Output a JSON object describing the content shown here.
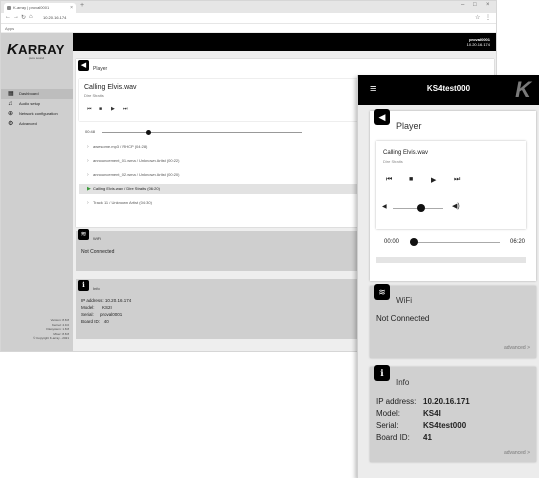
{
  "browser": {
    "tab_title": "K-array | proval0001",
    "new_tab": "+",
    "window_controls": [
      "–",
      "□",
      "×"
    ],
    "url": "10.20.16.174",
    "bookmarks": "Apps"
  },
  "desktop": {
    "logo": {
      "k": "K",
      "text": "ARRAY",
      "tagline": "pure sound"
    },
    "nav": [
      {
        "label": "Dashboard",
        "icon": "dashboard-icon"
      },
      {
        "label": "Audio setup",
        "icon": "music-icon"
      },
      {
        "label": "Network configuration",
        "icon": "network-icon"
      },
      {
        "label": "Advanced",
        "icon": "gear-icon"
      }
    ],
    "side_info": [
      "Version: 8.8.8",
      "Kernel: 4.9.0",
      "Filesystem: 1.8.8",
      "Mixer: 8.8.8",
      "© Copyright K-array - 2021"
    ],
    "device": {
      "name": "proval0001",
      "ip": "10.20.16.174"
    },
    "player": {
      "title": "Player",
      "track": "Calling Elvis.wav",
      "artist": "Dire Straits",
      "time": "00:48",
      "playlist": [
        "awesome.mp3 / RHCP (04:28)",
        "announcement_01.wma / Unknown Artist (00:22)",
        "announcement_02.wma / Unknown Artist (00:20)",
        "Calling Elvis.wav / Dire Straits (06:20)",
        "Track 11 / Unknown Artist (04:30)"
      ]
    },
    "wifi": {
      "title": "WiFi",
      "status": "Not Connected"
    },
    "info": {
      "title": "Info",
      "ip": "IP address: 10.20.16.174",
      "model": "Model:      KS2I",
      "serial": "Serial:     proval0001",
      "board": "Board ID:   40"
    }
  },
  "mobile": {
    "title": "KS4test000",
    "logo": "K",
    "player": {
      "title": "Player",
      "track": "Calling Elvis.wav",
      "artist": "Dire Straits",
      "time_start": "00:00",
      "time_end": "06:20",
      "volume_level": 0.55,
      "progress": 0.0
    },
    "wifi": {
      "title": "WiFi",
      "status": "Not Connected",
      "advanced": "advanced >"
    },
    "info": {
      "title": "Info",
      "ip_label": "IP address:",
      "ip_value": "10.20.16.171",
      "model_label": "Model:",
      "model_value": "KS4I",
      "serial_label": "Serial:",
      "serial_value": "KS4test000",
      "board_label": "Board ID:",
      "board_value": "41",
      "advanced": "advanced >"
    }
  }
}
